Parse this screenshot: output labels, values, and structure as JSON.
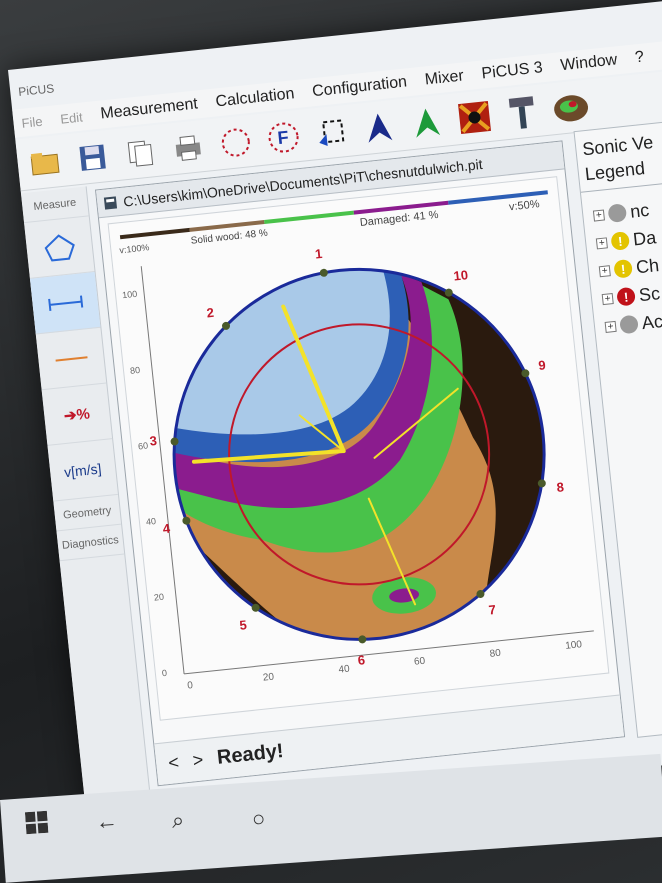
{
  "app": {
    "title": "PiCUS"
  },
  "menu": {
    "items": [
      "File",
      "Edit",
      "Measurement",
      "Calculation",
      "Configuration",
      "Mixer",
      "PiCUS 3",
      "Window",
      "?"
    ]
  },
  "left_panel": {
    "items": [
      "Measure",
      "Geometry",
      "Diagnostics"
    ],
    "unit_label": "v[m/s]",
    "percent_label": "%"
  },
  "document": {
    "path": "C:\\Users\\kim\\OneDrive\\Documents\\PiT\\chesnutdulwich.pit",
    "status": "Ready!",
    "nav_prev": "<",
    "nav_next": ">"
  },
  "tomogram": {
    "solid_label": "Solid wood: 48 %",
    "damaged_label": "Damaged: 41 %",
    "v_left": "v:100%",
    "v_right": "v:50%",
    "sensor_numbers": [
      "1",
      "2",
      "3",
      "4",
      "5",
      "6",
      "7",
      "8",
      "9",
      "10"
    ],
    "y_ticks": [
      "100",
      "80",
      "60",
      "40",
      "20",
      "0"
    ],
    "x_ticks": [
      "0",
      "20",
      "40",
      "60",
      "80",
      "100"
    ],
    "colors": {
      "solid": "#6b4a2a",
      "brown_bar": "#3a2a1a",
      "green": "#49c24a",
      "violet": "#8b1c8e",
      "blue": "#2d5fb6",
      "light_blue": "#a9c9e8",
      "yellow": "#f3e22a",
      "red": "#c0182a",
      "border": "#1a2a9a"
    }
  },
  "right_panel": {
    "title": "Sonic Ve",
    "tab": "Legend",
    "legend_items": [
      {
        "label": "nc",
        "icon": "grey-dot-icon",
        "color": "#9a9a9a"
      },
      {
        "label": "Da",
        "icon": "warning-yellow-icon",
        "color": "#e3c400"
      },
      {
        "label": "Ch",
        "icon": "warning-yellow-icon",
        "color": "#e3c400"
      },
      {
        "label": "Sc",
        "icon": "error-red-icon",
        "color": "#c0121a"
      },
      {
        "label": "Ac",
        "icon": "grey-dot-icon",
        "color": "#9a9a9a"
      }
    ]
  }
}
